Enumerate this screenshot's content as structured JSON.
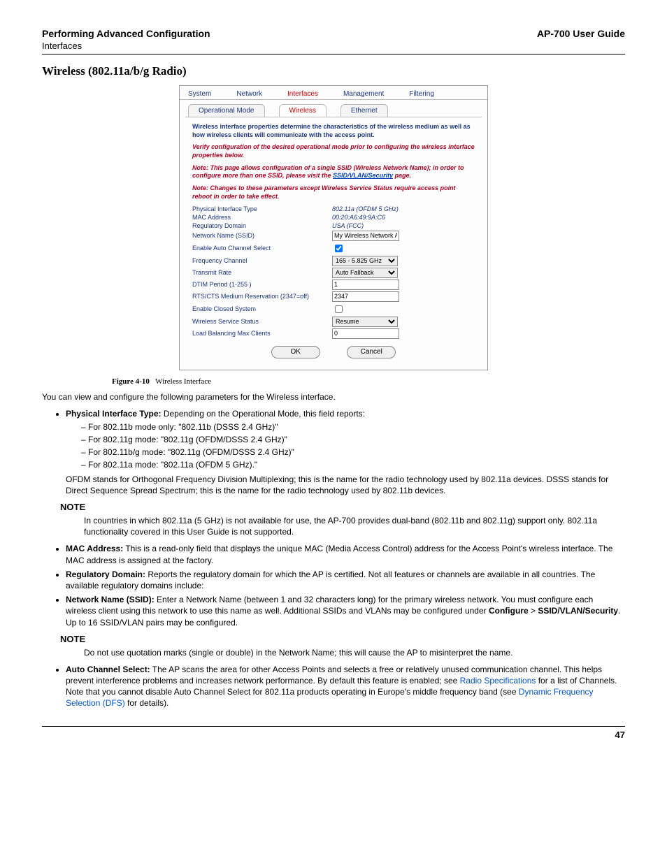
{
  "header": {
    "chapter_title": "Performing Advanced Configuration",
    "doc_title": "AP-700 User Guide",
    "breadcrumb": "Interfaces"
  },
  "section_title": "Wireless (802.11a/b/g Radio)",
  "panel": {
    "tabs": [
      "System",
      "Network",
      "Interfaces",
      "Management",
      "Filtering"
    ],
    "active_tab": "Interfaces",
    "subtabs": [
      "Operational Mode",
      "Wireless",
      "Ethernet"
    ],
    "active_subtab": "Wireless",
    "desc1": "Wireless interface properties determine the characteristics of the wireless medium as well as how wireless clients will communicate with the access point.",
    "desc2": "Verify configuration of the desired operational mode prior to configuring the wireless interface properties below.",
    "desc3_pre": "Note: This page allows configuration of a single SSID (Wireless Network Name); in order to configure more than one SSID, please visit the ",
    "desc3_link": "SSID/VLAN/Security",
    "desc3_post": " page.",
    "desc4": "Note: Changes to these parameters except Wireless Service Status require access point reboot in order to take effect.",
    "rows": {
      "phys_type": {
        "label": "Physical Interface Type",
        "value": "802.11a (OFDM 5 GHz)"
      },
      "mac": {
        "label": "MAC Address",
        "value": "00:20:A6:49:9A:C6"
      },
      "reg": {
        "label": "Regulatory Domain",
        "value": "USA (FCC)"
      },
      "ssid": {
        "label": "Network Name (SSID)",
        "value": "My Wireless Network A"
      },
      "autoch": {
        "label": "Enable Auto Channel Select"
      },
      "freq": {
        "label": "Frequency Channel",
        "value": "165 - 5.825 GHz"
      },
      "txrate": {
        "label": "Transmit Rate",
        "value": "Auto Fallback"
      },
      "dtim": {
        "label": "DTIM Period (1-255 )",
        "value": "1"
      },
      "rtscts": {
        "label": "RTS/CTS Medium Reservation (2347=off)",
        "value": "2347"
      },
      "closed": {
        "label": "Enable Closed System"
      },
      "svc": {
        "label": "Wireless Service Status",
        "value": "Resume"
      },
      "loadbal": {
        "label": "Load Balancing Max Clients",
        "value": "0"
      }
    },
    "buttons": {
      "ok": "OK",
      "cancel": "Cancel"
    }
  },
  "caption": {
    "label": "Figure 4-10",
    "text": "Wireless Interface"
  },
  "intro": "You can view and configure the following parameters for the Wireless interface.",
  "bullets": {
    "phys": {
      "lead": "Physical Interface Type:",
      "rest": " Depending on the Operational Mode, this field reports:",
      "items": [
        "For 802.11b mode only: \"802.11b (DSSS 2.4 GHz)\"",
        "For 802.11g mode: \"802.11g (OFDM/DSSS 2.4 GHz)\"",
        "For 802.11b/g mode: \"802.11g (OFDM/DSSS 2.4 GHz)\"",
        "For 802.11a mode: \"802.11a (OFDM 5 GHz).\""
      ],
      "tail": "OFDM stands for Orthogonal Frequency Division Multiplexing; this is the name for the radio technology used by 802.11a devices. DSSS stands for Direct Sequence Spread Spectrum; this is the name for the radio technology used by 802.11b devices."
    },
    "mac": {
      "lead": "MAC Address:",
      "rest": " This is a read-only field that displays the unique MAC (Media Access Control) address for the Access Point's wireless interface. The MAC address is assigned at the factory."
    },
    "reg": {
      "lead": "Regulatory Domain:",
      "rest": " Reports the regulatory domain for which the AP is certified. Not all features or channels are available in all countries. The available regulatory domains include:"
    },
    "ssid": {
      "lead": "Network Name (SSID):",
      "rest_pre": " Enter a Network Name (between 1 and 32 characters long) for the primary wireless network. You must configure each wireless client using this network to use this name as well. Additional SSIDs and VLANs may be configured under ",
      "rest_bold1": "Configure",
      "rest_mid": " > ",
      "rest_bold2": "SSID/VLAN/Security",
      "rest_post": ". Up to 16 SSID/VLAN pairs may be configured."
    },
    "autoch": {
      "lead": "Auto Channel Select:",
      "rest_pre": " The AP scans the area for other Access Points and selects a free or relatively unused communication channel. This helps prevent interference problems and increases network performance. By default this feature is enabled; see ",
      "link1": "Radio Specifications",
      "rest_mid": " for a list of Channels. Note that you cannot disable Auto Channel Select for 802.11a products operating in Europe's middle frequency band (see ",
      "link2": "Dynamic Frequency Selection (DFS)",
      "rest_post": " for details)."
    }
  },
  "notes": {
    "label": "NOTE",
    "n1": "In countries in which 802.11a (5 GHz) is not available for use, the AP-700 provides dual-band (802.11b and 802.11g) support only. 802.11a functionality covered in this User Guide is not supported.",
    "n2": "Do not use quotation marks (single or double) in the Network Name; this will cause the AP to misinterpret the name."
  },
  "page_number": "47"
}
